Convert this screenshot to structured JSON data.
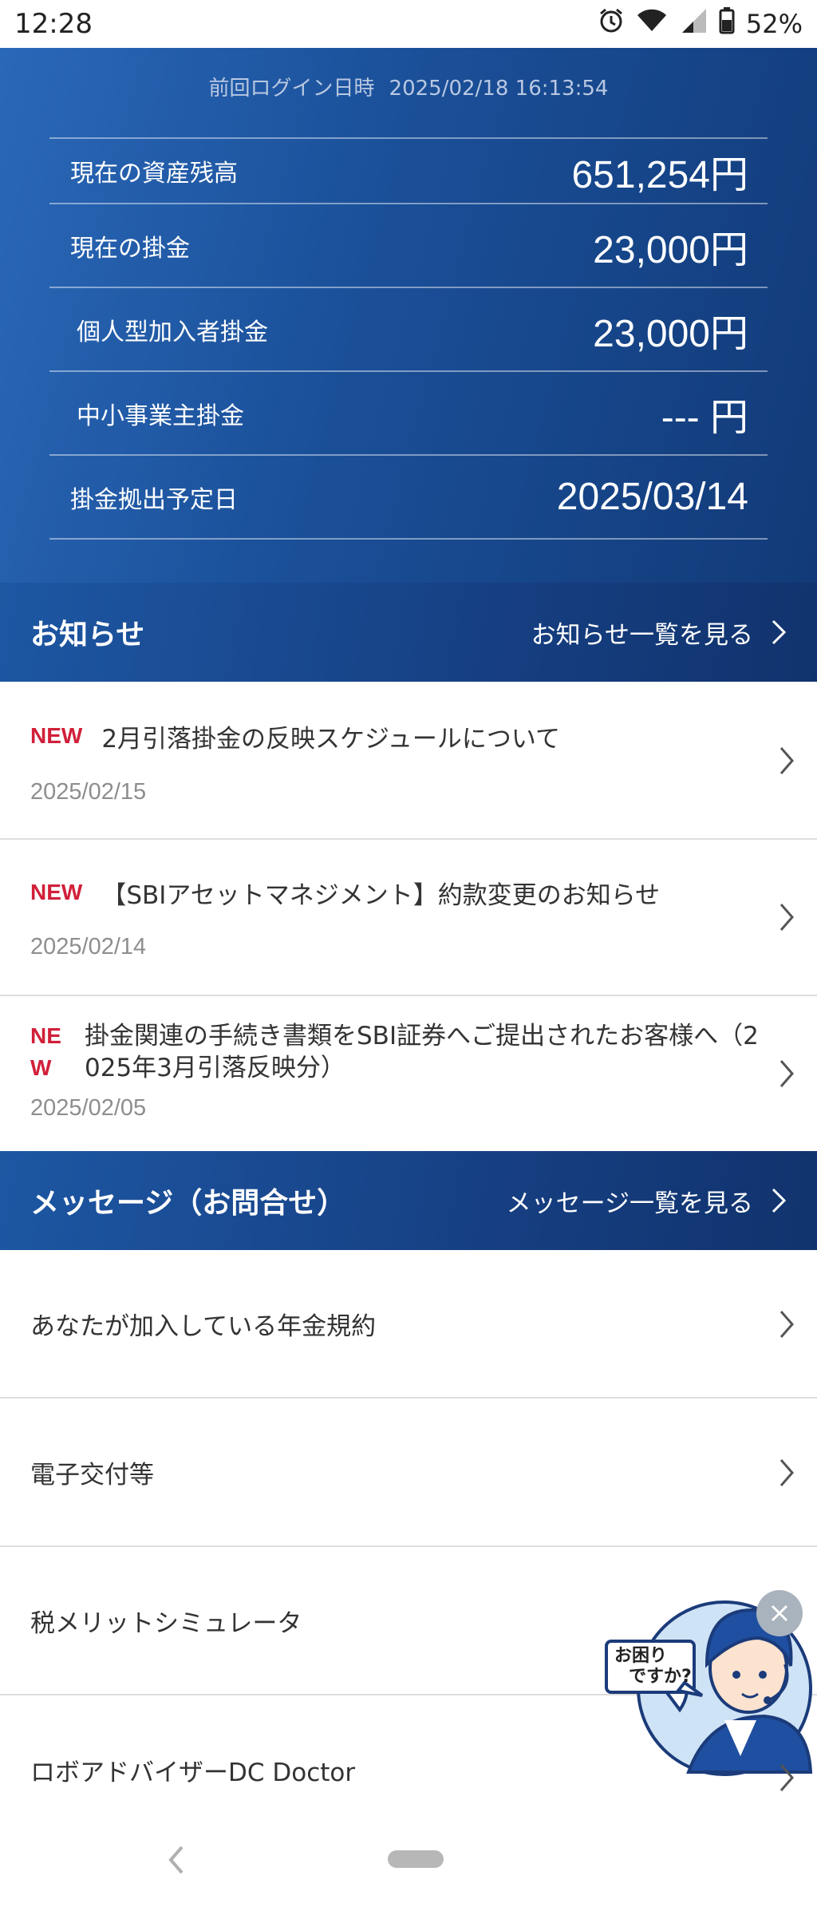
{
  "status_bar": {
    "time": "12:28",
    "battery": "52%",
    "icons": [
      "alarm-icon",
      "wifi-icon",
      "signal-icon",
      "battery-icon"
    ]
  },
  "summary": {
    "last_login_label": "前回ログイン日時",
    "last_login_value": "2025/02/18 16:13:54",
    "rows": [
      {
        "label": "現在の資産残高",
        "value": "651,254円"
      },
      {
        "label": "現在の掛金",
        "value": "23,000円"
      },
      {
        "label": "個人型加入者掛金",
        "value": "23,000円"
      },
      {
        "label": "中小事業主掛金",
        "value": "--- 円"
      },
      {
        "label": "掛金拠出予定日",
        "value": "2025/03/14"
      }
    ]
  },
  "notices": {
    "title": "お知らせ",
    "more": "お知らせ一覧を見る",
    "items": [
      {
        "badge": "NEW",
        "text": "2月引落掛金の反映スケジュールについて",
        "date": "2025/02/15"
      },
      {
        "badge": "NEW",
        "text": "【SBIアセットマネジメント】約款変更のお知らせ",
        "date": "2025/02/14"
      },
      {
        "badge_line1": "NE",
        "badge_line2": "W",
        "text_line1": "掛金関連の手続き書類をSBI証券へご提出されたお客様へ（2",
        "text_line2": "025年3月引落反映分）",
        "date": "2025/02/05"
      }
    ]
  },
  "messages": {
    "title": "メッセージ（お問合せ）",
    "more": "メッセージ一覧を見る"
  },
  "menu": [
    {
      "label": "あなたが加入している年金規約"
    },
    {
      "label": "電子交付等"
    },
    {
      "label": "税メリットシミュレータ"
    },
    {
      "label": "ロボアドバイザーDC Doctor"
    }
  ],
  "help_widget": {
    "bubble_line1": "お困り",
    "bubble_line2": "ですか?"
  },
  "colors": {
    "brand_blue": "#1a4f98",
    "new_badge": "#d1203a"
  }
}
